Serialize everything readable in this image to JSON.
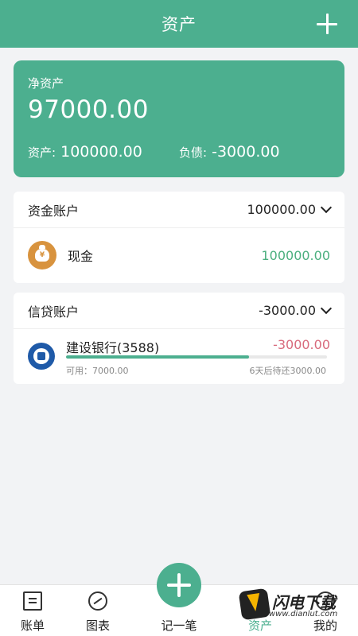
{
  "header": {
    "title": "资产",
    "add_icon": "plus-icon"
  },
  "net_card": {
    "label": "净资产",
    "value": "97000.00",
    "assets_label": "资产:",
    "assets_value": "100000.00",
    "debts_label": "负债:",
    "debts_value": "-3000.00"
  },
  "fund_section": {
    "name": "资金账户",
    "total": "100000.00",
    "accounts": [
      {
        "name": "现金",
        "amount": "100000.00",
        "icon": "money-bag-icon",
        "icon_glyph": "¥"
      }
    ]
  },
  "credit_section": {
    "name": "信贷账户",
    "total": "-3000.00",
    "accounts": [
      {
        "name": "建设银行(3588)",
        "amount": "-3000.00",
        "available": "可用：7000.00",
        "due": "6天后待还3000.00",
        "used_fraction": 0.7,
        "icon": "ccb-bank-icon"
      }
    ]
  },
  "tabbar": {
    "tabs": [
      {
        "label": "账单",
        "icon": "bill-icon"
      },
      {
        "label": "图表",
        "icon": "chart-icon"
      },
      {
        "label": "记一笔",
        "icon": "plus-icon"
      },
      {
        "label": "资产",
        "icon": "asset-icon",
        "active": true
      },
      {
        "label": "我的",
        "icon": "profile-icon"
      }
    ]
  },
  "watermark": {
    "text": "闪电下载",
    "url": "www.dianlut.com"
  },
  "colors": {
    "brand": "#4caf8f",
    "positive": "#4caf7f",
    "negative": "#d86a7c"
  }
}
